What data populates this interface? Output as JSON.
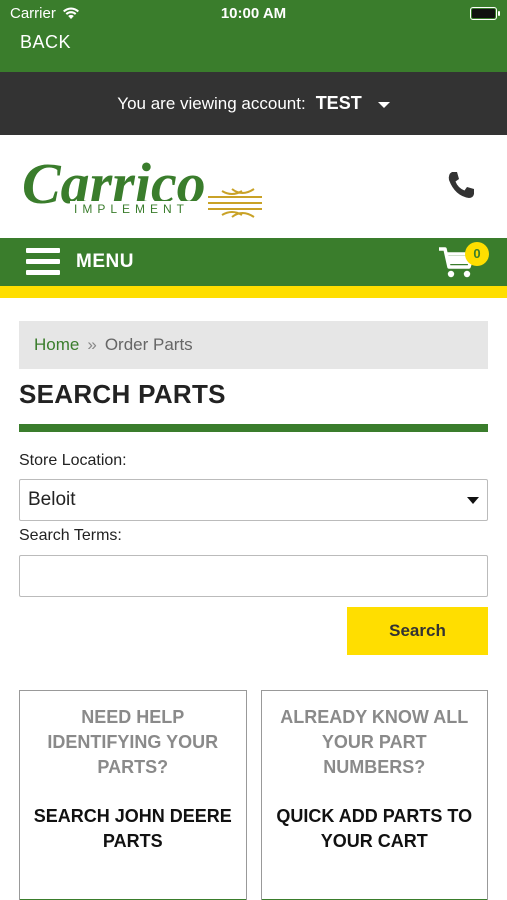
{
  "status_bar": {
    "carrier": "Carrier",
    "time": "10:00 AM"
  },
  "nav": {
    "back_label": "BACK"
  },
  "account": {
    "prefix": "You are viewing account:",
    "name": "TEST"
  },
  "brand": {
    "name": "Carrico",
    "tagline": "IMPLEMENT",
    "primary_color": "#3a7d2c",
    "accent_color": "#ffde00",
    "wheat_color": "#c9a227"
  },
  "menu": {
    "label": "MENU",
    "cart_count": "0"
  },
  "breadcrumb": {
    "home": "Home",
    "separator": "»",
    "current": "Order Parts"
  },
  "page": {
    "title": "SEARCH PARTS"
  },
  "form": {
    "store_label": "Store Location:",
    "store_value": "Beloit",
    "terms_label": "Search Terms:",
    "terms_value": "",
    "search_button": "Search"
  },
  "cards": [
    {
      "question": "NEED HELP IDENTIFYING YOUR PARTS?",
      "action": "SEARCH JOHN DEERE PARTS"
    },
    {
      "question": "ALREADY KNOW ALL YOUR PART NUMBERS?",
      "action": "QUICK ADD PARTS TO YOUR CART"
    }
  ]
}
